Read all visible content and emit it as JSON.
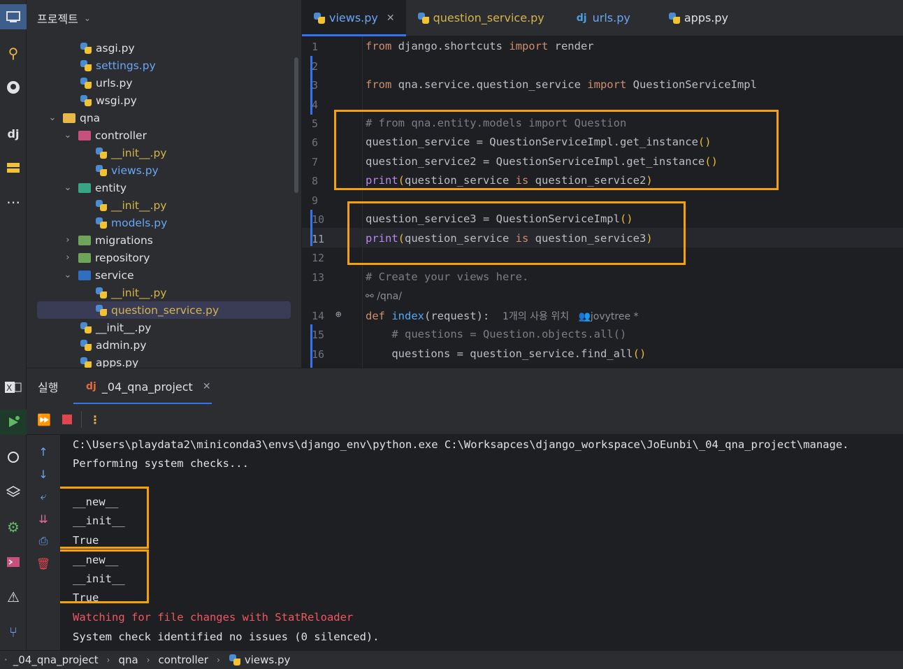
{
  "project_panel": {
    "title": "프로젝트",
    "tree": [
      {
        "label": "asgi.py",
        "indent": 3,
        "icon": "python-file-icon",
        "color": "default"
      },
      {
        "label": "settings.py",
        "indent": 3,
        "icon": "python-file-icon",
        "color": "blue"
      },
      {
        "label": "urls.py",
        "indent": 3,
        "icon": "python-file-icon",
        "color": "default"
      },
      {
        "label": "wsgi.py",
        "indent": 3,
        "icon": "python-file-icon",
        "color": "default"
      },
      {
        "label": "qna",
        "indent": 1,
        "icon": "folder-icon",
        "expanded": true
      },
      {
        "label": "controller",
        "indent": 2,
        "icon": "controller-folder-icon",
        "expanded": true
      },
      {
        "label": "__init__.py",
        "indent": 4,
        "icon": "python-file-icon",
        "color": "yellow"
      },
      {
        "label": "views.py",
        "indent": 4,
        "icon": "python-file-icon",
        "color": "blue"
      },
      {
        "label": "entity",
        "indent": 2,
        "icon": "entity-folder-icon",
        "expanded": true
      },
      {
        "label": "__init__.py",
        "indent": 4,
        "icon": "python-file-icon",
        "color": "yellow"
      },
      {
        "label": "models.py",
        "indent": 4,
        "icon": "python-file-icon",
        "color": "blue"
      },
      {
        "label": "migrations",
        "indent": 2,
        "icon": "migrations-folder-icon",
        "expanded": false
      },
      {
        "label": "repository",
        "indent": 2,
        "icon": "repository-folder-icon",
        "expanded": false
      },
      {
        "label": "service",
        "indent": 2,
        "icon": "service-folder-icon",
        "expanded": true
      },
      {
        "label": "__init__.py",
        "indent": 4,
        "icon": "python-file-icon",
        "color": "yellow"
      },
      {
        "label": "question_service.py",
        "indent": 4,
        "icon": "python-file-icon",
        "color": "yellow",
        "selected": true
      },
      {
        "label": "__init__.py",
        "indent": 3,
        "icon": "python-file-icon",
        "color": "default"
      },
      {
        "label": "admin.py",
        "indent": 3,
        "icon": "python-file-icon",
        "color": "default"
      },
      {
        "label": "apps.py",
        "indent": 3,
        "icon": "python-file-icon",
        "color": "default"
      }
    ]
  },
  "tabs": [
    {
      "label": "views.py",
      "active": true,
      "color": "#6aa6f5"
    },
    {
      "label": "question_service.py",
      "active": false,
      "color": "#d4b54a"
    },
    {
      "label": "urls.py",
      "active": false,
      "color": "#6aa6f5"
    },
    {
      "label": "apps.py",
      "active": false,
      "color": "#dfe1e5"
    }
  ],
  "editor": {
    "line_numbers": [
      "1",
      "2",
      "3",
      "4",
      "5",
      "6",
      "7",
      "8",
      "9",
      "10",
      "11",
      "12",
      "13",
      "14",
      "15",
      "16"
    ],
    "lines": {
      "l1_from": "from",
      "l1_mod": " django.shortcuts ",
      "l1_import": "import",
      "l1_name": " render",
      "l3_from": "from",
      "l3_mod": " qna.service.question_service ",
      "l3_import": "import",
      "l3_name": " QuestionServiceImpl",
      "l5": "# from qna.entity.models import Question",
      "l6_a": "question_service = QuestionServiceImpl.get_instance",
      "l6_p": "()",
      "l7_a": "question_service2 = QuestionServiceImpl.get_instance",
      "l7_p": "()",
      "l8_print": "print",
      "l8_o": "(",
      "l8_a": "question_service ",
      "l8_is": "is",
      "l8_b": " question_service2",
      "l8_c": ")",
      "l10_a": "question_service3 = QuestionServiceImpl",
      "l10_p": "()",
      "l11_print": "print",
      "l11_o": "(",
      "l11_a": "question_service ",
      "l11_is": "is",
      "l11_b": " question_service3",
      "l11_c": ")",
      "l13": "# Create your views here.",
      "l13_url": "/qna/",
      "l14_def": "def",
      "l14_fn": " index",
      "l14_args": "(request):",
      "l14_hint": "1개의 사용 위치",
      "l14_author": "jovytree *",
      "l15": "    # questions = Question.objects.all()",
      "l16_a": "    questions = question_service.find_all",
      "l16_p": "()"
    }
  },
  "run_panel": {
    "title": "실행",
    "tab_label": "_04_qna_project",
    "console": [
      "C:\\Users\\playdata2\\miniconda3\\envs\\django_env\\python.exe C:\\Worksapces\\django_workspace\\JoEunbi\\_04_qna_project\\manage.",
      "Performing system checks...",
      "__new__",
      "__init__",
      "True",
      "__new__",
      "__init__",
      "True",
      "Watching for file changes with StatReloader",
      "System check identified no issues (0 silenced)."
    ]
  },
  "breadcrumb": [
    "_04_qna_project",
    "qna",
    "controller",
    "views.py"
  ],
  "colors": {
    "highlight_box": "#f5a20a",
    "accent": "#3574f0",
    "keyword": "#cf8e6d",
    "function": "#56a8f5",
    "comment": "#7a7e85",
    "error_text": "#f0585f"
  }
}
